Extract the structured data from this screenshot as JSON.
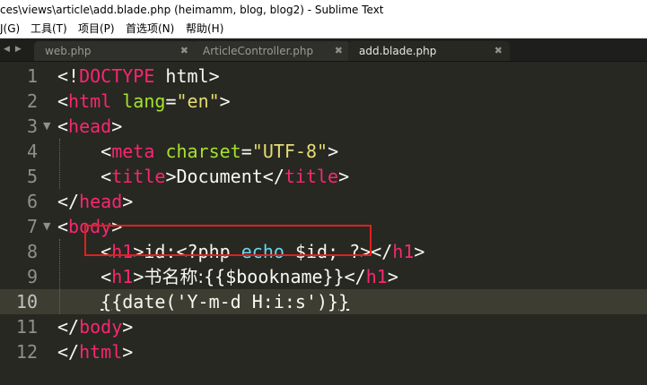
{
  "window": {
    "title": "ces\\views\\article\\add.blade.php (heimamm, blog, blog2) - Sublime Text"
  },
  "menu": {
    "items": [
      "J(G)",
      "工具(T)",
      "项目(P)",
      "首选项(N)",
      "帮助(H)"
    ]
  },
  "tabs": [
    {
      "label": "web.php",
      "active": false
    },
    {
      "label": "ArticleController.php",
      "active": false
    },
    {
      "label": "add.blade.php",
      "active": true
    }
  ],
  "tab_close_glyph": "✖",
  "nav_arrows": "◀▶",
  "editor": {
    "line_numbers": [
      "1",
      "2",
      "3",
      "4",
      "5",
      "6",
      "7",
      "8",
      "9",
      "10",
      "11",
      "12"
    ],
    "current_line": 10,
    "lines": [
      [
        [
          "pl",
          "<!"
        ],
        [
          "tg",
          "DOCTYPE"
        ],
        [
          "pl",
          " html>"
        ]
      ],
      [
        [
          "pl",
          "<"
        ],
        [
          "tg",
          "html"
        ],
        [
          "pl",
          " "
        ],
        [
          "at",
          "lang"
        ],
        [
          "pl",
          "="
        ],
        [
          "st",
          "\"en\""
        ],
        [
          "pl",
          ">"
        ]
      ],
      [
        [
          "pl",
          "<"
        ],
        [
          "tg",
          "head"
        ],
        [
          "pl",
          ">"
        ]
      ],
      [
        [
          "pl",
          "    <"
        ],
        [
          "tg",
          "meta"
        ],
        [
          "pl",
          " "
        ],
        [
          "at",
          "charset"
        ],
        [
          "pl",
          "="
        ],
        [
          "st",
          "\"UTF-8\""
        ],
        [
          "pl",
          ">"
        ]
      ],
      [
        [
          "pl",
          "    <"
        ],
        [
          "tg",
          "title"
        ],
        [
          "pl",
          ">Document</"
        ],
        [
          "tg",
          "title"
        ],
        [
          "pl",
          ">"
        ]
      ],
      [
        [
          "pl",
          "</"
        ],
        [
          "tg",
          "head"
        ],
        [
          "pl",
          ">"
        ]
      ],
      [
        [
          "pl",
          "<"
        ],
        [
          "tg",
          "body"
        ],
        [
          "pl",
          ">"
        ]
      ],
      [
        [
          "pl",
          "    <"
        ],
        [
          "tg",
          "h1"
        ],
        [
          "pl",
          ">id:<?php "
        ],
        [
          "kw",
          "echo"
        ],
        [
          "pl",
          " $id; ?></"
        ],
        [
          "tg",
          "h1"
        ],
        [
          "pl",
          ">"
        ]
      ],
      [
        [
          "pl",
          "    <"
        ],
        [
          "tg",
          "h1"
        ],
        [
          "pl",
          ">"
        ],
        [
          "cjk",
          "书名称:"
        ],
        [
          "pl",
          "{{$bookname}}</"
        ],
        [
          "tg",
          "h1"
        ],
        [
          "pl",
          ">"
        ]
      ],
      [
        [
          "pl",
          "    "
        ],
        [
          "ul",
          "{"
        ],
        [
          "pl",
          "{date('Y-m-d H:i:s')}"
        ],
        [
          "ul",
          "}"
        ]
      ],
      [
        [
          "pl",
          "</"
        ],
        [
          "tg",
          "body"
        ],
        [
          "pl",
          ">"
        ]
      ],
      [
        [
          "pl",
          "</"
        ],
        [
          "tg",
          "html"
        ],
        [
          "pl",
          ">"
        ]
      ]
    ],
    "fold_markers": {
      "3": "▼",
      "7": "▼"
    }
  },
  "colors": {
    "background": "#272822",
    "tag": "#f92672",
    "attribute": "#a6e22e",
    "string": "#e6db74",
    "keyword": "#66d9ef",
    "highlight_box": "#e02020"
  }
}
